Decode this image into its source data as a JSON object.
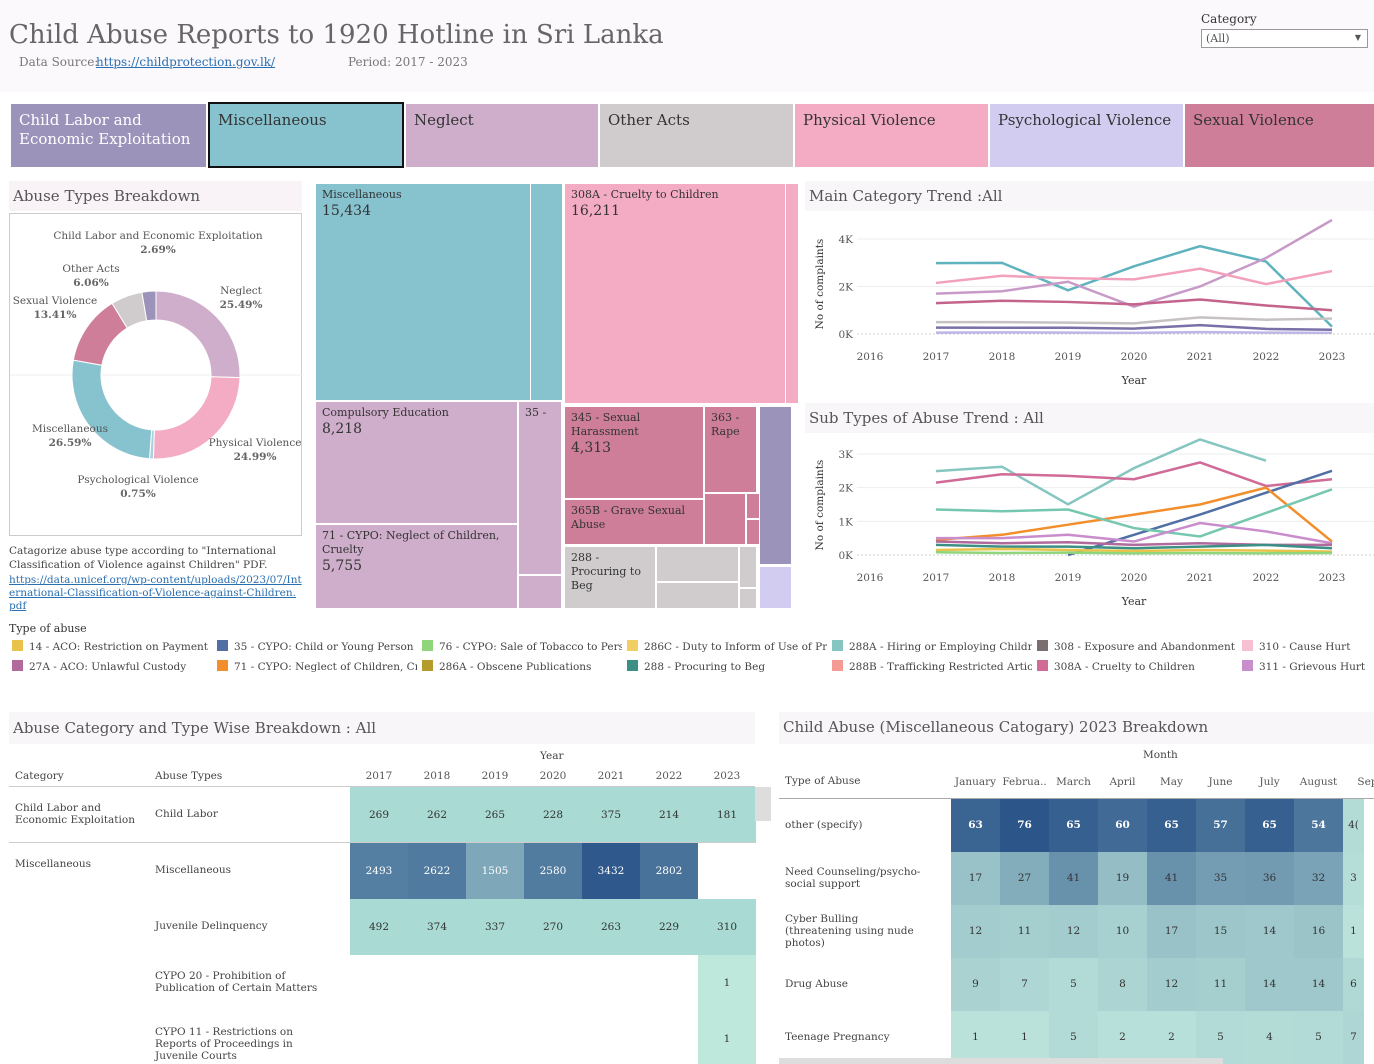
{
  "header": {
    "title": "Child Abuse Reports to 1920 Hotline in Sri Lanka",
    "source_label": "Data Source:",
    "source_link": "https://childprotection.gov.lk/",
    "period": "Period: 2017 - 2023",
    "filter_label": "Category",
    "filter_value": "(All)"
  },
  "tabs": [
    {
      "label": "Child Labor and Economic Exploitation",
      "color": "#9b93ba"
    },
    {
      "label": "Miscellaneous",
      "color": "#87c3cf"
    },
    {
      "label": "Neglect",
      "color": "#cfaecb"
    },
    {
      "label": "Other Acts",
      "color": "#d0cccd"
    },
    {
      "label": "Physical Violence",
      "color": "#f4acc4"
    },
    {
      "label": "Psychological Violence",
      "color": "#d2cdf0"
    },
    {
      "label": "Sexual Violence",
      "color": "#cf7e9a"
    }
  ],
  "donut": {
    "title": "Abuse Types Breakdown",
    "slices": [
      {
        "name": "Neglect",
        "pct": "25.49%",
        "value": 25.49,
        "color": "#cfaecb"
      },
      {
        "name": "Physical Violence",
        "pct": "24.99%",
        "value": 24.99,
        "color": "#f4acc4"
      },
      {
        "name": "Psychological Violence",
        "pct": "0.75%",
        "value": 0.75,
        "color": "#a9d2e0"
      },
      {
        "name": "Miscellaneous",
        "pct": "26.59%",
        "value": 26.59,
        "color": "#87c3cf"
      },
      {
        "name": "Sexual Violence",
        "pct": "13.41%",
        "value": 13.41,
        "color": "#cf7e9a"
      },
      {
        "name": "Other Acts",
        "pct": "6.06%",
        "value": 6.06,
        "color": "#d0cccd"
      },
      {
        "name": "Child Labor and Economic Exploitation",
        "pct": "2.69%",
        "value": 2.69,
        "color": "#9b93ba"
      }
    ],
    "note": "Catagorize abuse type according to \"International Classification of Violence against Children\" PDF.",
    "note_link": "https://data.unicef.org/wp-content/uploads/2023/07/International-Classification-of-Violence-against-Children.pdf"
  },
  "treemap": [
    {
      "label": "Miscellaneous",
      "value": "15,434"
    },
    {
      "label": "308A - Cruelty to Children",
      "value": "16,211"
    },
    {
      "label": "Compulsory Education",
      "value": "8,218"
    },
    {
      "label": "35 -",
      "value": ""
    },
    {
      "label": "71 - CYPO: Neglect of Children, Cruelty",
      "value": "5,755"
    },
    {
      "label": "345 - Sexual Harassment",
      "value": "4,313"
    },
    {
      "label": "363 - Rape",
      "value": ""
    },
    {
      "label": "365B - Grave Sexual Abuse",
      "value": ""
    },
    {
      "label": "288 - Procuring to Beg",
      "value": ""
    }
  ],
  "main_trend": {
    "title": "Main Category Trend :All",
    "ylabel": "No of complaints",
    "xlabel": "Year",
    "x_ticks": [
      "2016",
      "2017",
      "2018",
      "2019",
      "2020",
      "2021",
      "2022",
      "2023",
      "202"
    ],
    "y_ticks": [
      "0K",
      "2K",
      "4K"
    ]
  },
  "sub_trend": {
    "title": "Sub Types of Abuse Trend : All",
    "ylabel": "No of complaints",
    "xlabel": "Year",
    "x_ticks": [
      "2016",
      "2017",
      "2018",
      "2019",
      "2020",
      "2021",
      "2022",
      "2023",
      "202"
    ],
    "y_ticks": [
      "0K",
      "1K",
      "2K",
      "3K"
    ]
  },
  "chart_data": [
    {
      "type": "line",
      "title": "Main Category Trend :All",
      "xlabel": "Year",
      "ylabel": "No of complaints",
      "ylim": [
        0,
        5000
      ],
      "x": [
        2017,
        2018,
        2019,
        2020,
        2021,
        2022,
        2023
      ],
      "series": [
        {
          "name": "Miscellaneous",
          "color": "#5fb3be",
          "values": [
            2985,
            2996,
            1842,
            2850,
            3700,
            3050,
            310
          ]
        },
        {
          "name": "Neglect",
          "color": "#c79ac8",
          "values": [
            1700,
            1800,
            2200,
            1150,
            2000,
            3200,
            4800
          ]
        },
        {
          "name": "Physical Violence",
          "color": "#f2a0bc",
          "values": [
            2150,
            2450,
            2350,
            2300,
            2750,
            2100,
            2650
          ]
        },
        {
          "name": "Sexual Violence",
          "color": "#c4638c",
          "values": [
            1300,
            1400,
            1350,
            1250,
            1450,
            1200,
            1000
          ]
        },
        {
          "name": "Other Acts",
          "color": "#c6c2c3",
          "values": [
            500,
            500,
            480,
            450,
            700,
            600,
            650
          ]
        },
        {
          "name": "Child Labor and Economic Exploitation",
          "color": "#7a70a8",
          "values": [
            269,
            262,
            265,
            228,
            375,
            214,
            181
          ]
        },
        {
          "name": "Psychological Violence",
          "color": "#bdb6e6",
          "values": [
            60,
            70,
            60,
            50,
            80,
            60,
            50
          ]
        }
      ]
    },
    {
      "type": "line",
      "title": "Sub Types of Abuse Trend : All",
      "xlabel": "Year",
      "ylabel": "No of complaints",
      "ylim": [
        0,
        3500
      ],
      "x": [
        2017,
        2018,
        2019,
        2020,
        2021,
        2022,
        2023
      ],
      "series": [
        {
          "name": "Miscellaneous",
          "color": "#86c6c0",
          "values": [
            2493,
            2622,
            1505,
            2580,
            3432,
            2802,
            null
          ]
        },
        {
          "name": "308A - Cruelty to Children",
          "color": "#d06a97",
          "values": [
            2150,
            2400,
            2350,
            2250,
            2750,
            2050,
            2250
          ]
        },
        {
          "name": "35 - CYPO: Child or Young Person",
          "color": "#4f6fa5",
          "values": [
            null,
            null,
            0,
            600,
            1200,
            1850,
            2500
          ]
        },
        {
          "name": "71 - CYPO: Neglect of Children",
          "color": "#f28e2b",
          "values": [
            450,
            600,
            900,
            1200,
            1500,
            2000,
            400
          ]
        },
        {
          "name": "Hiring / Employing",
          "color": "#76c7b0",
          "values": [
            1350,
            1300,
            1350,
            800,
            550,
            1250,
            1950
          ]
        },
        {
          "name": "311 - Grievous Hurt",
          "color": "#c98ccc",
          "values": [
            500,
            500,
            600,
            400,
            950,
            700,
            350
          ]
        },
        {
          "name": "27A - ACO: Unlawful Custody",
          "color": "#b06a9c",
          "values": [
            400,
            350,
            380,
            300,
            350,
            300,
            300
          ]
        },
        {
          "name": "288 - Procuring to Beg",
          "color": "#3c8f84",
          "values": [
            300,
            250,
            250,
            200,
            250,
            300,
            200
          ]
        },
        {
          "name": "14 - ACO: Restriction on Payment",
          "color": "#e8c24a",
          "values": [
            150,
            180,
            150,
            120,
            150,
            130,
            100
          ]
        },
        {
          "name": "76 - CYPO: Sale of Tobacco",
          "color": "#8fd57c",
          "values": [
            80,
            60,
            70,
            50,
            60,
            50,
            60
          ]
        }
      ]
    }
  ],
  "legend": {
    "title": "Type of abuse",
    "items": [
      {
        "label": "14 - ACO: Restriction on Payment",
        "color": "#e8c24a"
      },
      {
        "label": "35 - CYPO: Child or Young Person i...",
        "color": "#4f6fa5"
      },
      {
        "label": "76 - CYPO: Sale of Tobacco to Pers...",
        "color": "#8fd57c"
      },
      {
        "label": "286C - Duty to Inform of Use of Pre...",
        "color": "#f1cf63"
      },
      {
        "label": "288A - Hiring or Employing Childr...",
        "color": "#86c6c0"
      },
      {
        "label": "308 - Exposure and Abandonment",
        "color": "#7a6f6e"
      },
      {
        "label": "310 - Cause Hurt",
        "color": "#f7bfd3"
      },
      {
        "label": "27A - ACO: Unlawful Custody",
        "color": "#b06a9c"
      },
      {
        "label": "71 - CYPO: Neglect of Children, Cr...",
        "color": "#f28e2b"
      },
      {
        "label": "286A - Obscene Publications",
        "color": "#b59a2c"
      },
      {
        "label": "288 - Procuring to Beg",
        "color": "#3c8f84"
      },
      {
        "label": "288B - Trafficking Restricted Articl...",
        "color": "#f59b95"
      },
      {
        "label": "308A - Cruelty to Children",
        "color": "#d06a97"
      },
      {
        "label": "311 - Grievous Hurt",
        "color": "#c98ccc"
      }
    ]
  },
  "table1": {
    "title": "Abuse Category and  Type Wise Breakdown : All",
    "col_header": "Year",
    "category_header": "Category",
    "types_header": "Abuse Types",
    "years": [
      "2017",
      "2018",
      "2019",
      "2020",
      "2021",
      "2022",
      "2023"
    ],
    "rows": [
      {
        "category": "Child Labor and Economic Exploitation",
        "type": "Child Labor",
        "values": [
          "269",
          "262",
          "265",
          "228",
          "375",
          "214",
          "181"
        ]
      },
      {
        "category": "Miscellaneous",
        "type": "Miscellaneous",
        "values": [
          "2493",
          "2622",
          "1505",
          "2580",
          "3432",
          "2802",
          ""
        ]
      },
      {
        "category": "",
        "type": "Juvenile Delinquency",
        "values": [
          "492",
          "374",
          "337",
          "270",
          "263",
          "229",
          "310"
        ]
      },
      {
        "category": "",
        "type": "CYPO 20 - Prohibition of Publication of Certain Matters",
        "values": [
          "",
          "",
          "",
          "",
          "",
          "",
          "1"
        ]
      },
      {
        "category": "",
        "type": "CYPO 11 - Restrictions on Reports of Proceedings in Juvenile Courts",
        "values": [
          "",
          "",
          "",
          "",
          "",
          "",
          "1"
        ]
      }
    ]
  },
  "table2": {
    "title": "Child Abuse (Miscellaneous Catogary) 2023 Breakdown",
    "col_header": "Month",
    "type_header": "Type of Abuse",
    "months": [
      "January",
      "Februa..",
      "March",
      "April",
      "May",
      "June",
      "July",
      "August",
      "Sep"
    ],
    "rows": [
      {
        "type": "other (specify)",
        "values": [
          "63",
          "76",
          "65",
          "60",
          "65",
          "57",
          "65",
          "54",
          "4("
        ]
      },
      {
        "type": "Need Counseling/psycho-social support",
        "values": [
          "17",
          "27",
          "41",
          "19",
          "41",
          "35",
          "36",
          "32",
          "3"
        ]
      },
      {
        "type": "Cyber Bulling (threatening using nude photos)",
        "values": [
          "12",
          "11",
          "12",
          "10",
          "17",
          "15",
          "14",
          "16",
          "1"
        ]
      },
      {
        "type": "Drug Abuse",
        "values": [
          "9",
          "7",
          "5",
          "8",
          "12",
          "11",
          "14",
          "14",
          "6"
        ]
      },
      {
        "type": "Teenage Pregnancy",
        "values": [
          "1",
          "1",
          "5",
          "2",
          "2",
          "5",
          "4",
          "5",
          "7"
        ]
      }
    ]
  }
}
